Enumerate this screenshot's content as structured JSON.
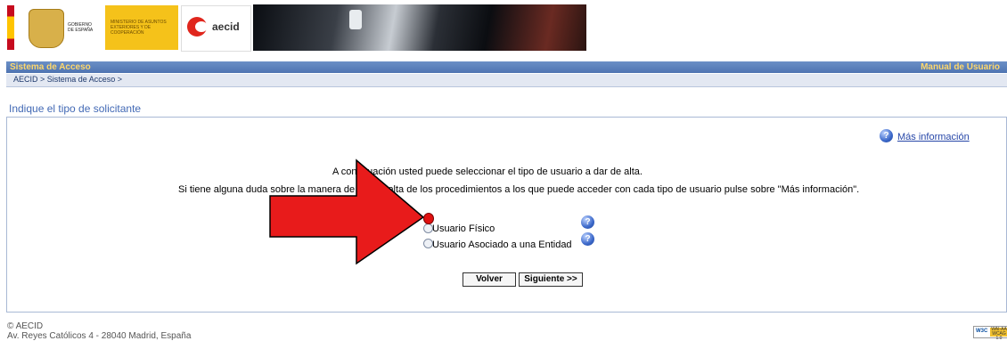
{
  "header": {
    "gov_text": "GOBIERNO DE ESPAÑA",
    "ministry_text": "MINISTERIO DE ASUNTOS EXTERIORES Y DE COOPERACIÓN",
    "aecid_text": "aecid"
  },
  "titlebar": {
    "title": "Sistema de Acceso",
    "manual_link": "Manual de Usuario"
  },
  "breadcrumb": "AECID > Sistema de Acceso >",
  "section_title": "Indique el tipo de solicitante",
  "more_info": "Más información",
  "instructions": {
    "line1": "A continuación usted puede seleccionar el tipo de usuario a dar de alta.",
    "line2": "Si tiene alguna duda sobre la manera de dar de alta de los procedimientos a los que puede acceder con cada tipo de usuario pulse sobre \"Más información\"."
  },
  "options": [
    {
      "label": "Usuario Físico",
      "selected": false
    },
    {
      "label": "Usuario Asociado a una Entidad",
      "selected": false
    }
  ],
  "buttons": {
    "back": "Volver",
    "next": "Siguiente >>"
  },
  "footer": {
    "org": "© AECID",
    "address": "Av. Reyes Católicos 4 - 28040 Madrid, España"
  },
  "badge": {
    "w3c": "W3C",
    "wai": "WAI-AA WCAG 1.0"
  },
  "colors": {
    "titlebar": "#5b7fbd",
    "accent_text": "#ffd86b",
    "link": "#2747a8",
    "annotation_arrow": "#e81b1b"
  }
}
